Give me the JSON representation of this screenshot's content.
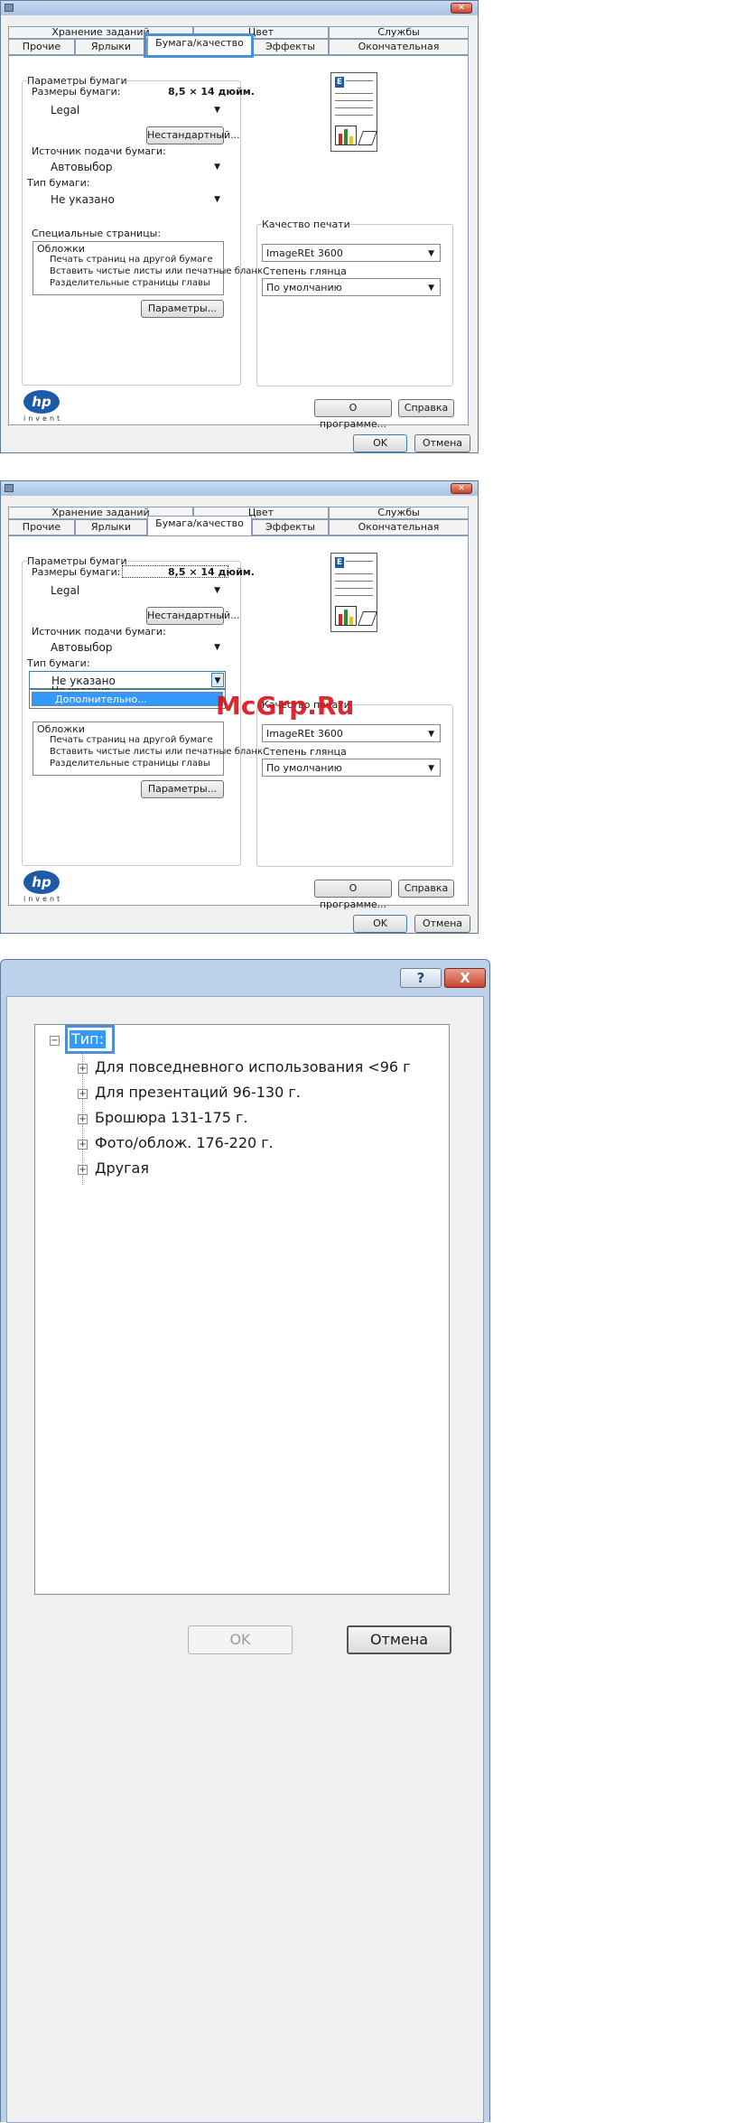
{
  "dialog1": {
    "tabs_row1": [
      "Хранение заданий",
      "Цвет",
      "Службы"
    ],
    "tabs_row2": [
      "Прочие",
      "Ярлыки",
      "Бумага/качество",
      "Эффекты",
      "Окончательная обработка"
    ],
    "paper_options_label": "Параметры бумаги",
    "paper_sizes_label": "Размеры бумаги:",
    "paper_sizes_value": "8,5 × 14 дюйм.",
    "paper_size_select": "Legal",
    "custom_button": "Нестандартный...",
    "paper_source_label": "Источник подачи бумаги:",
    "paper_source_select": "Автовыбор",
    "paper_type_label": "Тип бумаги:",
    "paper_type_select": "Не указано",
    "special_pages_label": "Специальные страницы:",
    "special_pages_items": [
      "Обложки",
      "Печать страниц на другой бумаге",
      "Вставить чистые листы или печатные бланк",
      "Разделительные страницы главы"
    ],
    "settings_button": "Параметры...",
    "print_quality_label": "Качество печати",
    "print_quality_select": "ImageREt 3600",
    "gloss_label": "Степень глянца",
    "gloss_select": "По умолчанию",
    "logo_text": "hp",
    "invent_text": "invent",
    "about_button": "О программе...",
    "help_button": "Справка",
    "ok_button": "OK",
    "cancel_button": "Отмена"
  },
  "dialog2": {
    "tabs_row1": [
      "Хранение заданий",
      "Цвет",
      "Службы"
    ],
    "tabs_row2": [
      "Прочие",
      "Ярлыки",
      "Бумага/качество",
      "Эффекты",
      "Окончательная обработка"
    ],
    "paper_options_label": "Параметры бумаги",
    "paper_sizes_label": "Размеры бумаги:",
    "paper_sizes_value": "8,5 × 14 дюйм.",
    "paper_size_select": "Legal",
    "custom_button": "Нестандартный...",
    "paper_source_label": "Источник подачи бумаги:",
    "paper_source_select": "Автовыбор",
    "paper_type_label": "Тип бумаги:",
    "paper_type_select": "Не указано",
    "dropdown_option_partial": "Не указано",
    "dropdown_option_selected": "Дополнительно...",
    "special_pages_items": [
      "Обложки",
      "Печать страниц на другой бумаге",
      "Вставить чистые листы или печатные бланк",
      "Разделительные страницы главы"
    ],
    "settings_button": "Параметры...",
    "print_quality_label": "Качество печати",
    "print_quality_select": "ImageREt 3600",
    "gloss_label": "Степень глянца",
    "gloss_select": "По умолчанию",
    "logo_text": "hp",
    "invent_text": "invent",
    "about_button": "О программе...",
    "help_button": "Справка",
    "ok_button": "OK",
    "cancel_button": "Отмена"
  },
  "watermark": "McGrp.Ru",
  "dialog3": {
    "help_glyph": "?",
    "close_glyph": "X",
    "tree_root": "Тип:",
    "tree_items": [
      "Для повседневного использования <96 г",
      "Для презентаций 96-130 г.",
      "Брошюра 131-175 г.",
      "Фото/облож. 176-220 г.",
      "Другая"
    ],
    "ok_button": "OK",
    "cancel_button": "Отмена"
  }
}
